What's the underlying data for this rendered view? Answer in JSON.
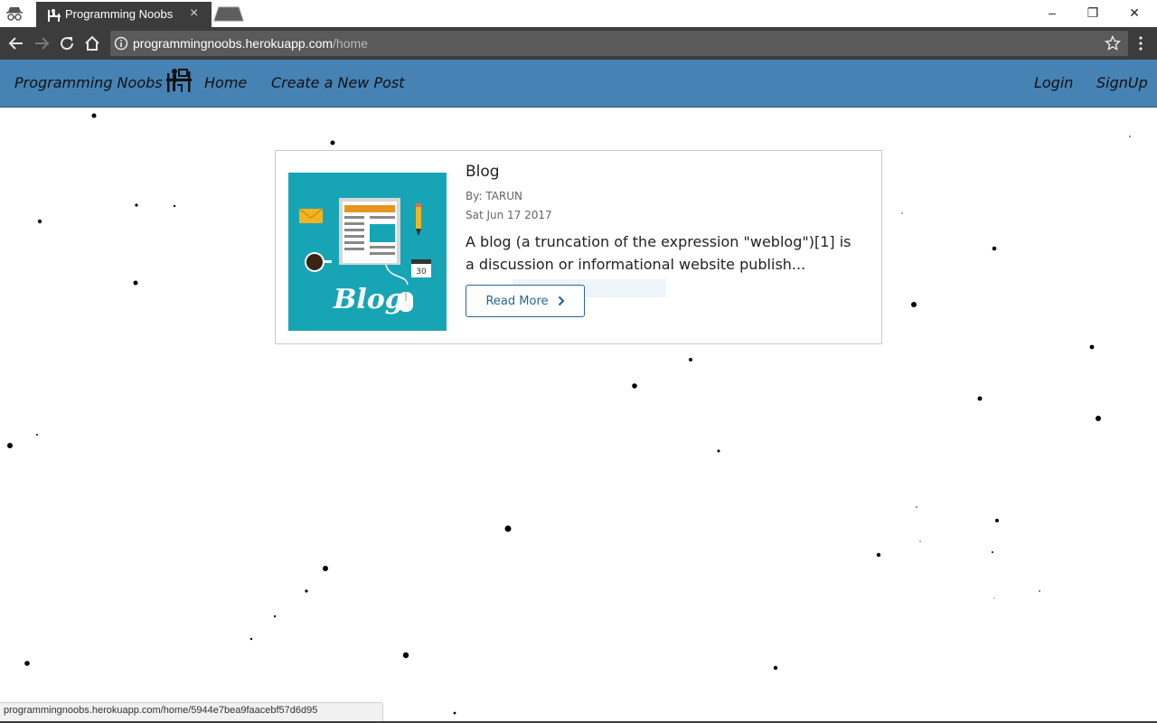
{
  "browser": {
    "tab_title": "Programming Noobs",
    "tab_close": "×",
    "url_host": "programmingnoobs.herokuapp.com",
    "url_path": "/home",
    "status_url": "programmingnoobs.herokuapp.com/home/5944e7bea9faacebf57d6d95",
    "window_controls": [
      "–",
      "❐",
      "✕"
    ]
  },
  "navbar": {
    "brand": "Programming Noobs",
    "links": [
      "Home",
      "Create a New Post"
    ],
    "right_links": [
      "Login",
      "SignUp"
    ],
    "color": "#4682b4"
  },
  "post": {
    "title": "Blog",
    "author": "By: TARUN",
    "date": "Sat Jun 17 2017",
    "excerpt": "A blog (a truncation of the expression \"weblog\")[1] is a discussion or informational website publish...",
    "read_more": "Read More",
    "thumb_text": "Blog",
    "thumb_badge": "30",
    "accent": "#2a6496"
  }
}
